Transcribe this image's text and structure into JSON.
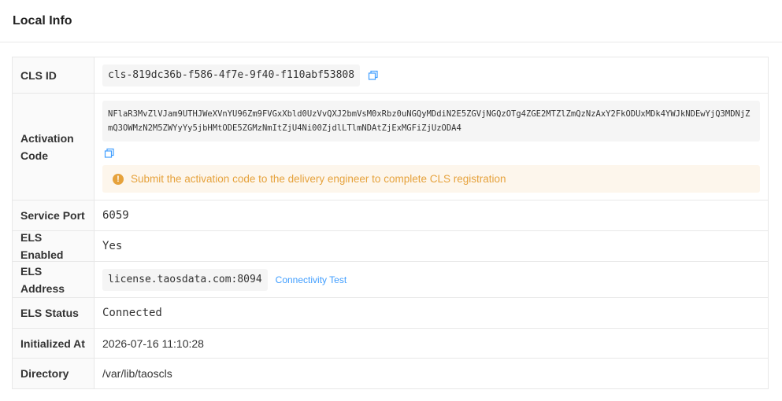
{
  "header": {
    "title": "Local Info"
  },
  "rows": {
    "cls_id": {
      "label": "CLS ID",
      "value": "cls-819dc36b-f586-4f7e-9f40-f110abf53808"
    },
    "activation": {
      "label": "Activation Code",
      "value": "NFlaR3MvZlVJam9UTHJWeXVnYU96Zm9FVGxXbld0UzVvQXJ2bmVsM0xRbz0uNGQyMDdiN2E5ZGVjNGQzOTg4ZGE2MTZlZmQzNzAxY2FkODUxMDk4YWJkNDEwYjQ3MDNjZmQ3OWMzN2M5ZWYyYy5jbHMtODE5ZGMzNmItZjU4Ni00ZjdlLTlmNDAtZjExMGFiZjUzODA4",
      "notice": "Submit the activation code to the delivery engineer to complete CLS registration"
    },
    "service_port": {
      "label": "Service Port",
      "value": "6059"
    },
    "els_enabled": {
      "label": "ELS Enabled",
      "value": "Yes"
    },
    "els_address": {
      "label": "ELS Address",
      "value": "license.taosdata.com:8094",
      "link": "Connectivity Test"
    },
    "els_status": {
      "label": "ELS Status",
      "value": "Connected"
    },
    "initialized_at": {
      "label": "Initialized At",
      "value": "2026-07-16 11:10:28"
    },
    "directory": {
      "label": "Directory",
      "value": "/var/lib/taoscls"
    }
  },
  "colors": {
    "warning": "#e6a23c",
    "link": "#409eff",
    "warning_bg": "#fdf6ec"
  },
  "icons": {
    "copy": "copy-icon",
    "alert": "exclamation-circle-icon"
  }
}
